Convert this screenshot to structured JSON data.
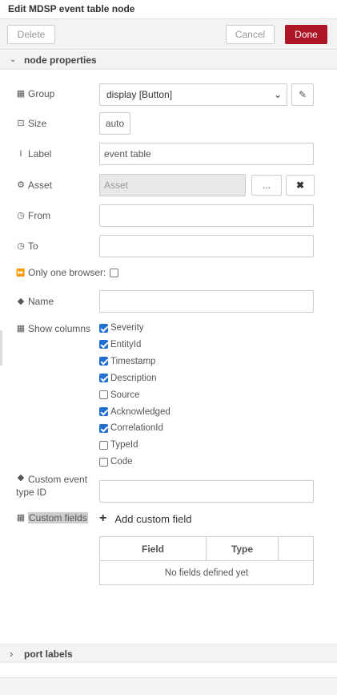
{
  "title": "Edit MDSP event table node",
  "toolbar": {
    "delete_label": "Delete",
    "cancel_label": "Cancel",
    "done_label": "Done"
  },
  "sections": {
    "node_properties": "node properties",
    "port_labels": "port labels"
  },
  "form": {
    "group": {
      "label": "Group",
      "value": "display [Button]"
    },
    "size": {
      "label": "Size",
      "value": "auto"
    },
    "label": {
      "label": "Label",
      "value": "event table"
    },
    "asset": {
      "label": "Asset",
      "placeholder": "Asset",
      "browse": "...",
      "clear": "✖"
    },
    "from": {
      "label": "From",
      "value": ""
    },
    "to": {
      "label": "To",
      "value": ""
    },
    "only_one_browser": {
      "label": "Only one browser:",
      "checked": false
    },
    "name": {
      "label": "Name",
      "value": ""
    },
    "show_columns": {
      "label": "Show columns",
      "items": [
        {
          "label": "Severity",
          "checked": true
        },
        {
          "label": "EntityId",
          "checked": true
        },
        {
          "label": "Timestamp",
          "checked": true
        },
        {
          "label": "Description",
          "checked": true
        },
        {
          "label": "Source",
          "checked": false
        },
        {
          "label": "Acknowledged",
          "checked": true
        },
        {
          "label": "CorrelationId",
          "checked": true
        },
        {
          "label": "TypeId",
          "checked": false
        },
        {
          "label": "Code",
          "checked": false
        }
      ]
    },
    "custom_event_type": {
      "label_line1": "Custom event",
      "label_line2": "type ID",
      "value": ""
    },
    "custom_fields": {
      "label": "Custom fields",
      "add_label": "Add custom field",
      "add_icon": "+"
    },
    "fields_table": {
      "columns": [
        "Field",
        "Type",
        ""
      ],
      "empty_text": "No fields defined yet"
    }
  },
  "icons": {
    "table": "▦",
    "size": "⊡",
    "text_cursor": "I",
    "asset": "⚙",
    "clock": "◷",
    "forward": "⏩",
    "tag": "◆",
    "pencil": "✎",
    "chevron_down": "⌄",
    "chevron_right": "›"
  }
}
